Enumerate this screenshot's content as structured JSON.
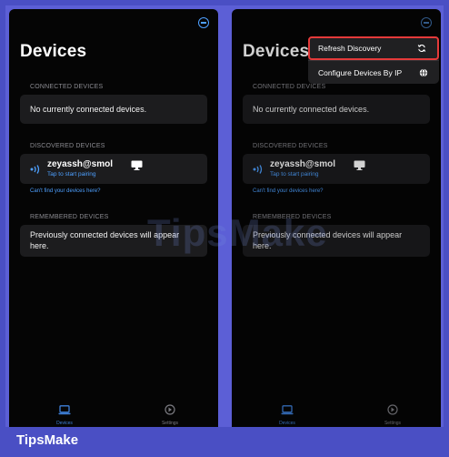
{
  "screens": [
    {
      "title": "Devices",
      "connected_header": "CONNECTED DEVICES",
      "connected_empty": "No currently connected devices.",
      "discovered_header": "DISCOVERED DEVICES",
      "device_name": "zeyassh@smol",
      "device_subtitle": "Tap to start pairing",
      "cant_find_link": "Can't find your devices here?",
      "remembered_header": "REMEMBERED DEVICES",
      "remembered_empty": "Previously connected devices will appear here.",
      "tabs": [
        "Devices",
        "Settings"
      ]
    },
    {
      "title": "Devices",
      "connected_header": "CONNECTED DEVICES",
      "connected_empty": "No currently connected devices.",
      "discovered_header": "DISCOVERED DEVICES",
      "device_name": "zeyassh@smol",
      "device_subtitle": "Tap to start pairing",
      "cant_find_link": "Can't find your devices here?",
      "remembered_header": "REMEMBERED DEVICES",
      "remembered_empty": "Previously connected devices will appear here.",
      "tabs": [
        "Devices",
        "Settings"
      ]
    }
  ],
  "dropdown": {
    "items": [
      {
        "label": "Refresh Discovery",
        "icon": "refresh-icon"
      },
      {
        "label": "Configure Devices By IP",
        "icon": "globe-icon"
      }
    ]
  },
  "watermark": "TipsMake",
  "brand": "TipsMake",
  "colors": {
    "accent": "#4ea0ff",
    "frame": "#4a4fc4",
    "highlight": "#e53a3a"
  }
}
